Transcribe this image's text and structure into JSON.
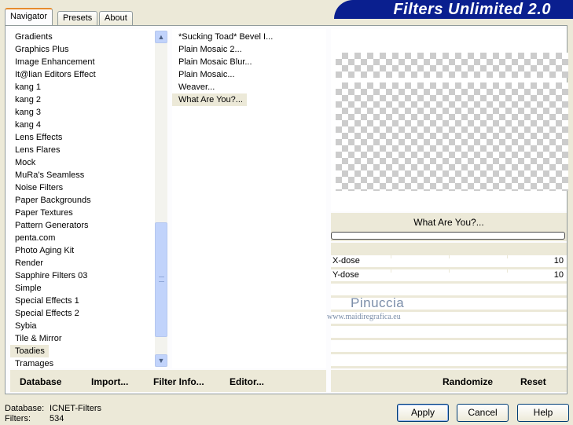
{
  "window": {
    "banner_title": "Filters Unlimited 2.0"
  },
  "tabs": [
    {
      "label": "Navigator",
      "active": true
    },
    {
      "label": "Presets",
      "active": false
    },
    {
      "label": "About",
      "active": false
    }
  ],
  "categories": [
    "Gradients",
    "Graphics Plus",
    "Image Enhancement",
    "It@lian Editors Effect",
    "kang 1",
    "kang 2",
    "kang 3",
    "kang 4",
    "Lens Effects",
    "Lens Flares",
    "Mock",
    "MuRa's Seamless",
    "Noise Filters",
    "Paper Backgrounds",
    "Paper Textures",
    "Pattern Generators",
    "penta.com",
    "Photo Aging Kit",
    "Render",
    "Sapphire Filters 03",
    "Simple",
    "Special Effects 1",
    "Special Effects 2",
    "Sybia",
    "Tile & Mirror",
    "Toadies",
    "Tramages"
  ],
  "selected_category": "Toadies",
  "filters": [
    "*Sucking Toad*  Bevel I...",
    "Plain Mosaic 2...",
    "Plain Mosaic Blur...",
    "Plain Mosaic...",
    "Weaver...",
    "What Are You?..."
  ],
  "selected_filter": "What Are You?...",
  "preview": {
    "filter_name": "What Are You?...",
    "params": [
      {
        "label": "X-dose",
        "value": "10"
      },
      {
        "label": "Y-dose",
        "value": "10"
      }
    ],
    "progress": 0
  },
  "watermark": {
    "line1": "Pinuccia",
    "line2": "www.maidiregrafica.eu"
  },
  "panel_buttons": {
    "database": "Database",
    "import": "Import...",
    "filter_info": "Filter Info...",
    "editor": "Editor...",
    "randomize": "Randomize",
    "reset": "Reset"
  },
  "status": {
    "database_label": "Database:",
    "database_value": "ICNET-Filters",
    "filters_label": "Filters:",
    "filters_value": "534"
  },
  "dialog_buttons": {
    "apply": "Apply",
    "cancel": "Cancel",
    "help": "Help"
  },
  "colors": {
    "banner": "#0a1f8f",
    "dialog_bg": "#ece9d8",
    "scrollbar": "#c1d3fb"
  }
}
